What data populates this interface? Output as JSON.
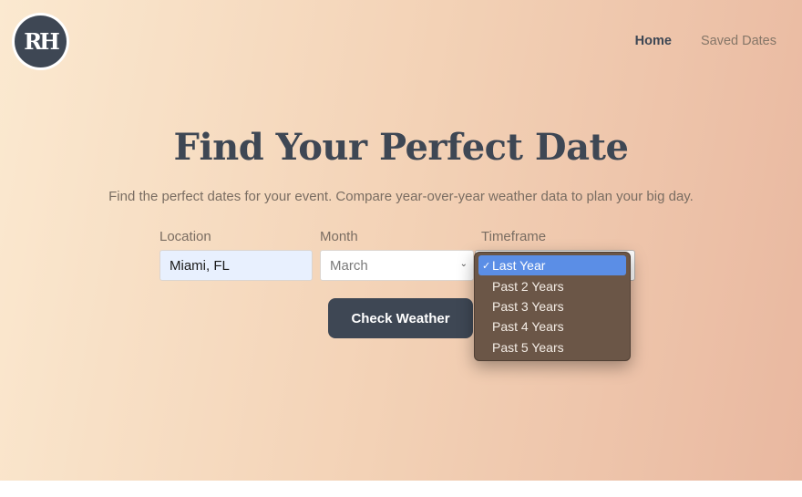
{
  "logo": {
    "text": "RH"
  },
  "nav": {
    "home": "Home",
    "saved": "Saved Dates"
  },
  "hero": {
    "title": "Find Your Perfect Date",
    "subtitle": "Find the perfect dates for your event. Compare year-over-year weather data to plan your big day."
  },
  "form": {
    "location_label": "Location",
    "location_value": "Miami, FL",
    "month_label": "Month",
    "month_value": "March",
    "timeframe_label": "Timeframe",
    "submit_label": "Check Weather"
  },
  "timeframe_options": [
    {
      "label": "Last Year",
      "selected": true
    },
    {
      "label": "Past 2 Years",
      "selected": false
    },
    {
      "label": "Past 3 Years",
      "selected": false
    },
    {
      "label": "Past 4 Years",
      "selected": false
    },
    {
      "label": "Past 5 Years",
      "selected": false
    }
  ],
  "colors": {
    "primary": "#3e4754",
    "selection": "#5b8ee6",
    "dropdown_bg": "#6b5647"
  },
  "icons": {
    "select_chevron": "chevron-down-icon",
    "selected_mark": "checkmark-icon"
  }
}
